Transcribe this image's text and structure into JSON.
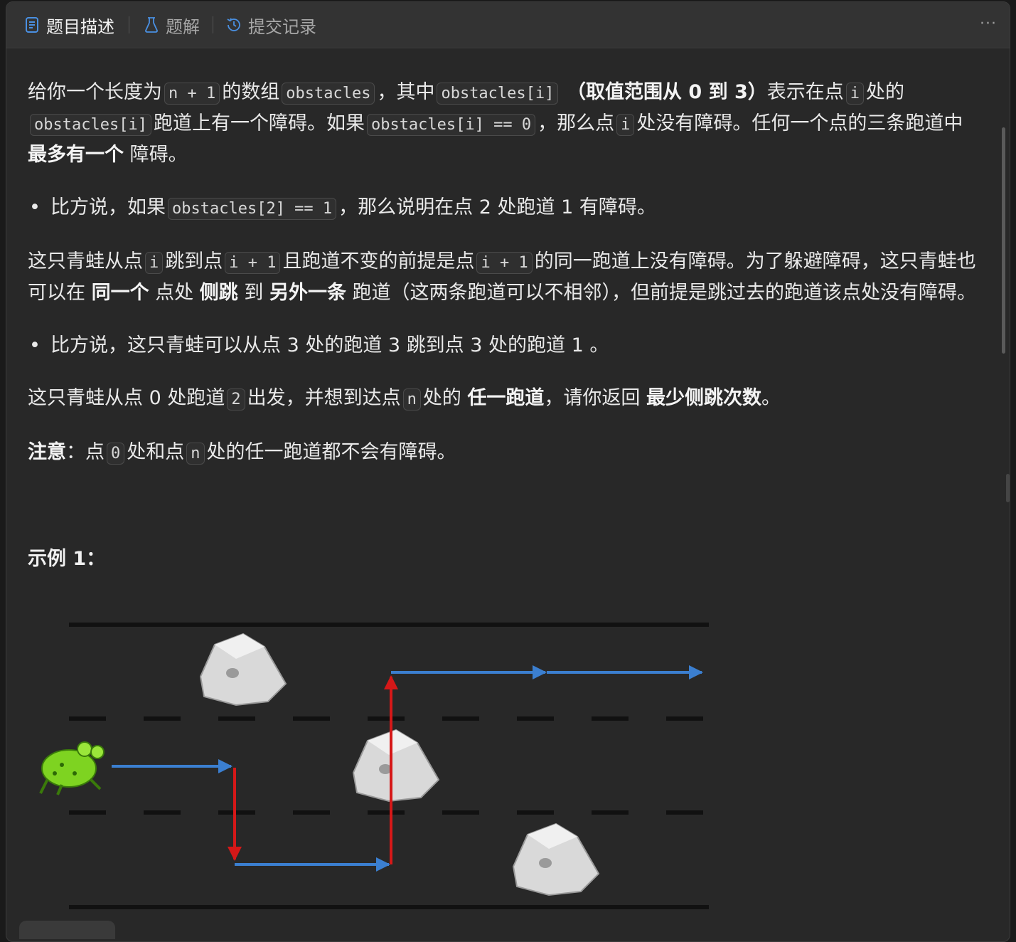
{
  "tabs": {
    "description": "题目描述",
    "solutions": "题解",
    "submissions": "提交记录",
    "more": "···"
  },
  "problem": {
    "p1": {
      "t1": "给你一个长度为",
      "c1": "n + 1",
      "t2": "的数组",
      "c2": "obstacles",
      "t3": "，其中",
      "c3": "obstacles[i]",
      "b1": "（取值范围从 0 到 3）",
      "t4": "表示在点",
      "c4": "i",
      "t5": "处的",
      "c5": "obstacles[i]",
      "t6": "跑道上有一个障碍。如果",
      "c6": "obstacles[i] == 0",
      "t7": "，那么点",
      "c7": "i",
      "t8": "处没有障碍。任何一个点的三条跑道中",
      "b2": "最多有一个",
      "t9": "障碍。"
    },
    "bullet1": {
      "t1": "比方说，如果",
      "c1": "obstacles[2] == 1",
      "t2": "，那么说明在点 2 处跑道 1 有障碍。"
    },
    "p2": {
      "t1": "这只青蛙从点",
      "c1": "i",
      "t2": "跳到点",
      "c2": "i + 1",
      "t3": "且跑道不变的前提是点",
      "c3": "i + 1",
      "t4": "的同一跑道上没有障碍。为了躲避障碍，这只青蛙也可以在",
      "b1": "同一个",
      "t5": "点处",
      "b2": "侧跳",
      "t6": "到",
      "b3": "另外一条",
      "t7": "跑道（这两条跑道可以不相邻），但前提是跳过去的跑道该点处没有障碍。"
    },
    "bullet2": {
      "t1": "比方说，这只青蛙可以从点 3 处的跑道 3 跳到点 3 处的跑道 1 。"
    },
    "p3": {
      "t1": "这只青蛙从点 0 处跑道",
      "c1": "2",
      "t2": "出发，并想到达点",
      "c2": "n",
      "t3": "处的",
      "b1": "任一跑道",
      "t4": "，请你返回",
      "b2": "最少侧跳次数",
      "t5": "。"
    },
    "note": {
      "b1": "注意",
      "t1": "：点",
      "c1": "0",
      "t2": "处和点",
      "c2": "n",
      "t3": "处的任一跑道都不会有障碍。"
    },
    "example_title": "示例 1："
  },
  "colors": {
    "arrow_blue": "#3b7fd0",
    "arrow_red": "#d51818",
    "lane_line": "#111111",
    "frog_green": "#7ed321"
  }
}
